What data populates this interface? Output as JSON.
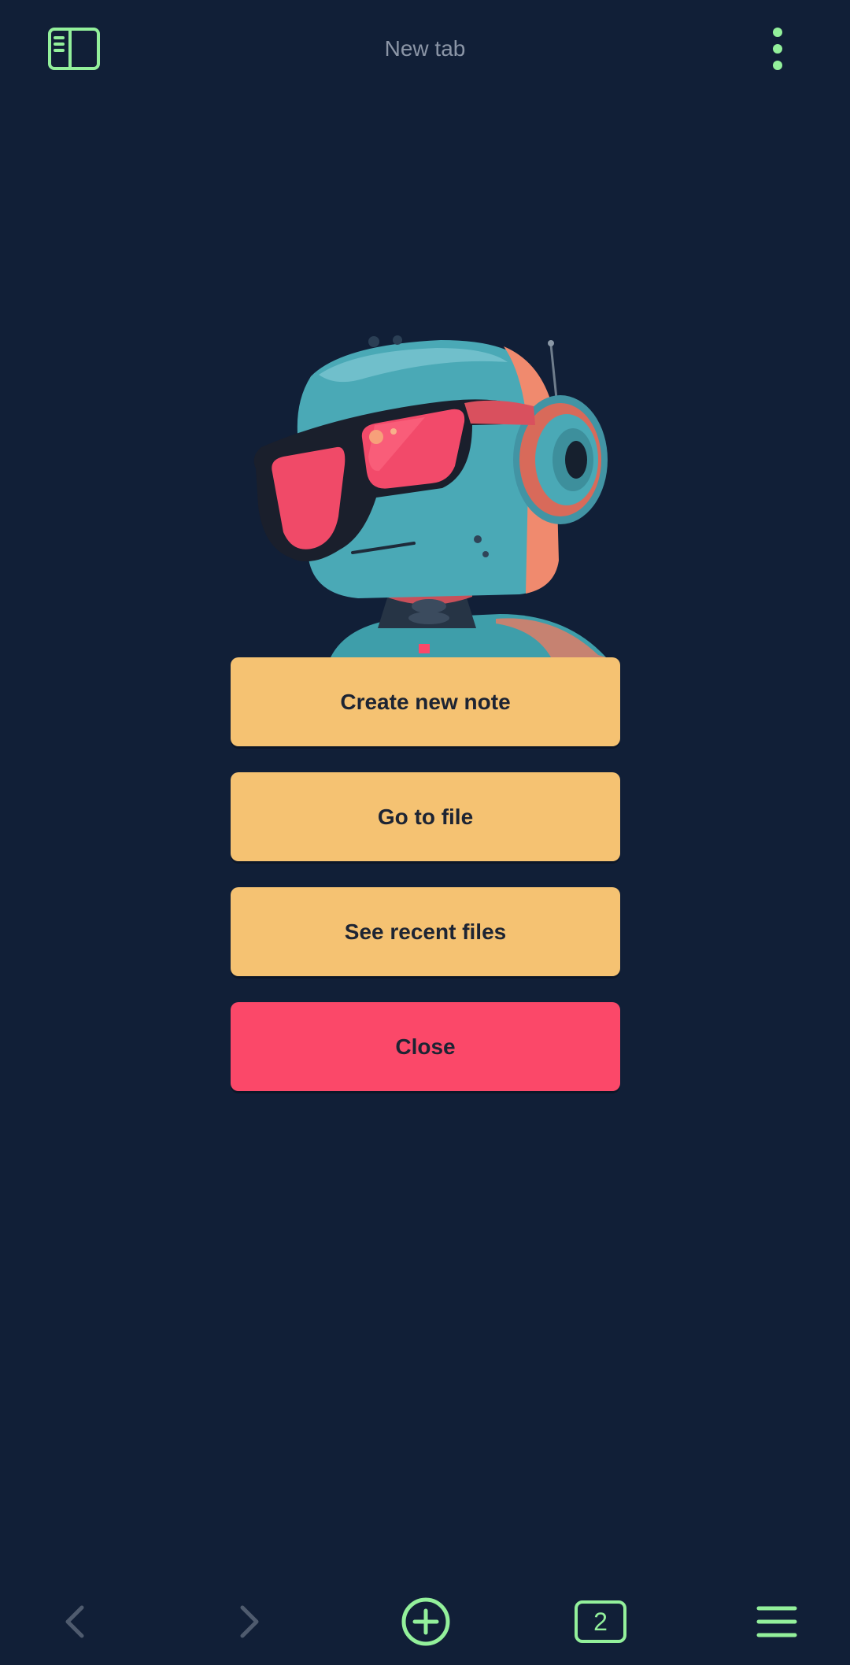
{
  "header": {
    "title": "New tab",
    "sidebar_icon": "sidebar-toggle-icon",
    "more_icon": "more-vertical-icon"
  },
  "actions": {
    "create_note": "Create new note",
    "go_to_file": "Go to file",
    "see_recent": "See recent files",
    "close": "Close"
  },
  "bottom_nav": {
    "back_icon": "chevron-left-icon",
    "forward_icon": "chevron-right-icon",
    "new_tab_icon": "plus-circle-icon",
    "tab_count": "2",
    "menu_icon": "menu-icon"
  },
  "colors": {
    "background": "#111f37",
    "accent": "#93f09b",
    "primary_button": "#f5c272",
    "close_button": "#fb4869",
    "disabled_icon": "#4f5b6e",
    "title_text": "#8b95a6"
  }
}
